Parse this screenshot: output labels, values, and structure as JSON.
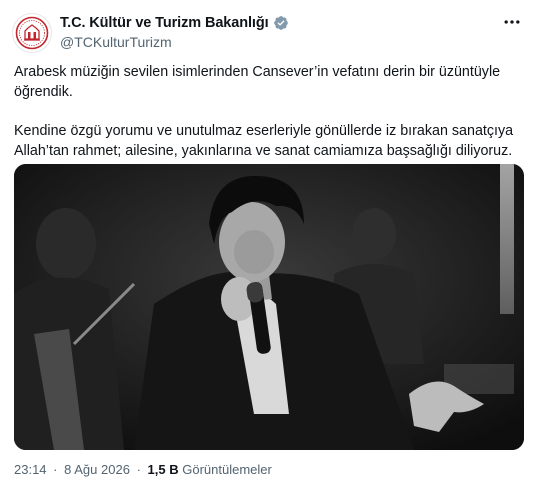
{
  "account": {
    "display_name": "T.C. Kültür ve Turizm Bakanlığı",
    "handle": "@TCKulturTurizm",
    "avatar_icon": "ministry-seal-icon",
    "verified_icon": "verified-badge-icon",
    "verified_color": "#829aab"
  },
  "tweet": {
    "paragraph1": "Arabesk müziğin sevilen isimlerinden Cansever’in vefatını derin bir üzüntüyle\nöğrendik.",
    "paragraph2": "Kendine özgü yorumu ve unutulmaz eserleriyle gönüllerde iz bırakan sanatçıya\nAllah’tan rahmet; ailesine, yakınlarına ve sanat camiamıza başsağlığı diliyoruz.",
    "media_icon": "photo-singer-microphone",
    "more_icon": "more-options-icon"
  },
  "meta": {
    "time": "23:14",
    "separator": "·",
    "date": "8 Ağu 2026",
    "separator2": "·",
    "views_count": "1,5 B",
    "views_label": "Görüntülemeler"
  },
  "colors": {
    "text": "#0f1419",
    "secondary": "#536471",
    "seal": "#c1272d"
  }
}
